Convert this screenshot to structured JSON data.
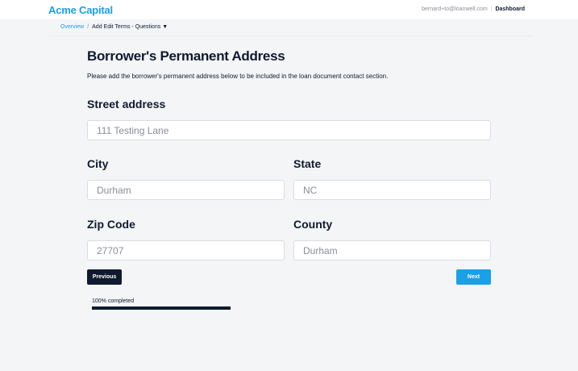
{
  "header": {
    "brand": "Acme Capital",
    "user_email": "bernard+to@loanwell.com",
    "separator": "|",
    "dashboard_link": "Dashboard"
  },
  "breadcrumb": {
    "overview": "Overview",
    "separator": "/",
    "current": "Add Edit Terms - Questions",
    "caret": "▼"
  },
  "form": {
    "title": "Borrower's Permanent Address",
    "description": "Please add the borrower's permanent address below to be included in the loan document contact section.",
    "street": {
      "label": "Street address",
      "value": "111 Testing Lane"
    },
    "city": {
      "label": "City",
      "value": "Durham"
    },
    "state": {
      "label": "State",
      "value": "NC"
    },
    "zip": {
      "label": "Zip Code",
      "value": "27707"
    },
    "county": {
      "label": "County",
      "value": "Durham"
    }
  },
  "actions": {
    "previous_label": "Previous",
    "next_label": "Next"
  },
  "progress": {
    "label": "100% completed",
    "fraction": 1.0
  },
  "colors": {
    "brand": "#1aa0e6",
    "dark": "#0f1a2e",
    "background": "#f4f5f7"
  }
}
